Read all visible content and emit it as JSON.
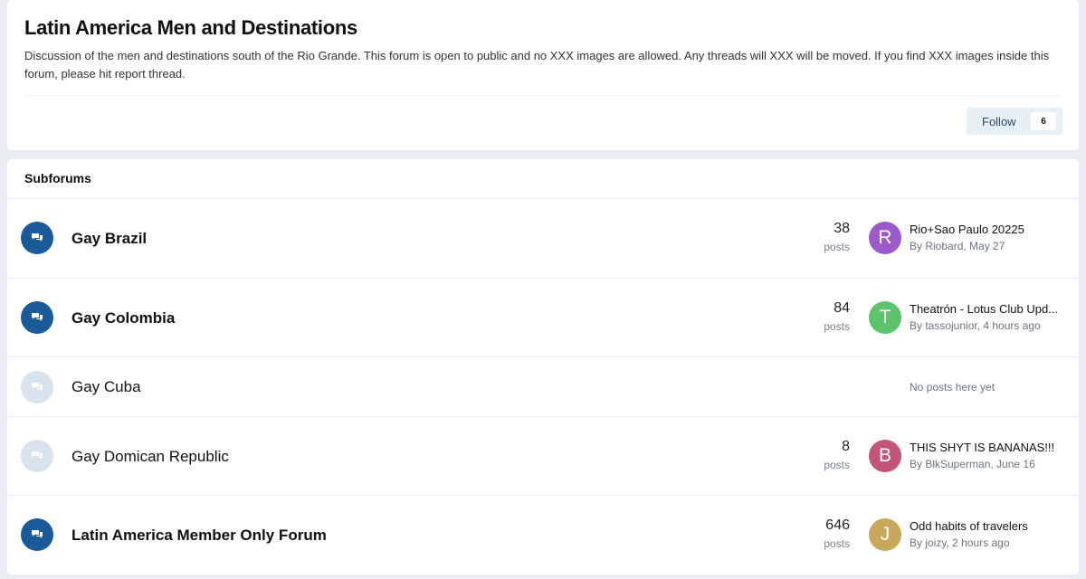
{
  "header": {
    "title": "Latin America Men and Destinations",
    "description": "Discussion of the men and destinations south of the Rio Grande. This forum is open to public and no XXX images are allowed. Any threads will XXX will be moved. If you find XXX images inside this forum, please hit report thread.",
    "follow_label": "Follow",
    "follow_count": "6"
  },
  "subforums": {
    "title": "Subforums",
    "items": [
      {
        "name": "Gay Brazil",
        "unread": true,
        "posts": "38",
        "posts_label": "posts",
        "avatar_letter": "R",
        "avatar_color": "#9b59c9",
        "last_title": "Rio+Sao Paulo 20225",
        "last_by": "By Riobard, May 27"
      },
      {
        "name": "Gay Colombia",
        "unread": true,
        "posts": "84",
        "posts_label": "posts",
        "avatar_letter": "T",
        "avatar_color": "#5cc46a",
        "last_title": "Theatrón - Lotus Club Upd...",
        "last_by": "By tassojunior, 4 hours ago"
      },
      {
        "name": "Gay Cuba",
        "unread": false,
        "empty_msg": "No posts here yet"
      },
      {
        "name": "Gay Domican Republic",
        "unread": false,
        "posts": "8",
        "posts_label": "posts",
        "avatar_letter": "B",
        "avatar_color": "#c4557a",
        "last_title": "THIS SHYT IS BANANAS!!!",
        "last_by": "By BlkSuperman, June 16"
      },
      {
        "name": "Latin America Member Only Forum",
        "unread": true,
        "posts": "646",
        "posts_label": "posts",
        "avatar_letter": "J",
        "avatar_color": "#c9a85c",
        "last_title": "Odd habits of travelers",
        "last_by": "By joizy, 2 hours ago"
      }
    ]
  }
}
